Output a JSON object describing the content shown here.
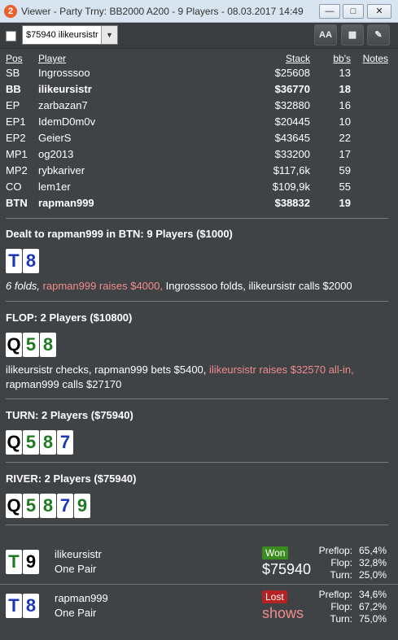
{
  "window": {
    "app_icon": "2",
    "title": "Viewer - Party Trny: BB2000 A200 - 9 Players - 08.03.2017 14:49",
    "minimize_icon": "minimize-icon",
    "maximize_icon": "maximize-icon",
    "close_icon": "close-icon"
  },
  "toolbar": {
    "hand_select_value": "$75940 ilikeursistr",
    "font_button": "AA",
    "grid_icon": "grid-icon",
    "edit_icon": "pencil-icon"
  },
  "table": {
    "headers": {
      "pos": "Pos",
      "player": "Player",
      "stack": "Stack",
      "bbs": "bb's",
      "notes": "Notes"
    },
    "rows": [
      {
        "pos": "SB",
        "player": "Ingrosssoo",
        "stack": "$25608",
        "bbs": "13",
        "bold": false
      },
      {
        "pos": "BB",
        "player": "ilikeursistr",
        "stack": "$36770",
        "bbs": "18",
        "bold": true
      },
      {
        "pos": "EP",
        "player": "zarbazan7",
        "stack": "$32880",
        "bbs": "16",
        "bold": false
      },
      {
        "pos": "EP1",
        "player": "IdemD0m0v",
        "stack": "$20445",
        "bbs": "10",
        "bold": false
      },
      {
        "pos": "EP2",
        "player": "GeierS",
        "stack": "$43645",
        "bbs": "22",
        "bold": false
      },
      {
        "pos": "MP1",
        "player": "og2013",
        "stack": "$33200",
        "bbs": "17",
        "bold": false
      },
      {
        "pos": "MP2",
        "player": "rybkariver",
        "stack": "$117,6k",
        "bbs": "59",
        "bold": false
      },
      {
        "pos": "CO",
        "player": "lem1er",
        "stack": "$109,9k",
        "bbs": "55",
        "bold": false
      },
      {
        "pos": "BTN",
        "player": "rapman999",
        "stack": "$38832",
        "bbs": "19",
        "bold": true
      }
    ]
  },
  "preflop": {
    "heading": "Dealt to rapman999 in BTN: 9 Players ($1000)",
    "cards": [
      {
        "rank": "T",
        "suit": "d"
      },
      {
        "rank": "8",
        "suit": "d"
      }
    ],
    "action_folds": "6 folds,",
    "action_raise": "rapman999 raises $4000,",
    "action_rest": "Ingrosssoo folds, ilikeursistr calls $2000"
  },
  "flop": {
    "heading": "FLOP: 2 Players ($10800)",
    "cards": [
      {
        "rank": "Q",
        "suit": "s"
      },
      {
        "rank": "5",
        "suit": "c"
      },
      {
        "rank": "8",
        "suit": "c"
      }
    ],
    "action_a": "ilikeursistr checks, rapman999 bets $5400,",
    "action_b": "ilikeursistr raises $32570 all-in,",
    "action_c": "rapman999 calls $27170"
  },
  "turn": {
    "heading": "TURN: 2 Players ($75940)",
    "cards": [
      {
        "rank": "Q",
        "suit": "s"
      },
      {
        "rank": "5",
        "suit": "c"
      },
      {
        "rank": "8",
        "suit": "c"
      },
      {
        "rank": "7",
        "suit": "d"
      }
    ]
  },
  "river": {
    "heading": "RIVER: 2 Players ($75940)",
    "cards": [
      {
        "rank": "Q",
        "suit": "s"
      },
      {
        "rank": "5",
        "suit": "c"
      },
      {
        "rank": "8",
        "suit": "c"
      },
      {
        "rank": "7",
        "suit": "d"
      },
      {
        "rank": "9",
        "suit": "c"
      }
    ]
  },
  "results": [
    {
      "cards": [
        {
          "rank": "T",
          "suit": "c"
        },
        {
          "rank": "9",
          "suit": "s"
        }
      ],
      "player": "ilikeursistr",
      "hand": "One Pair",
      "badge": "Won",
      "amount": "$75940",
      "stats": [
        {
          "label": "Preflop:",
          "value": "65,4%"
        },
        {
          "label": "Flop:",
          "value": "32,8%"
        },
        {
          "label": "Turn:",
          "value": "25,0%"
        }
      ]
    },
    {
      "cards": [
        {
          "rank": "T",
          "suit": "d"
        },
        {
          "rank": "8",
          "suit": "d"
        }
      ],
      "player": "rapman999",
      "hand": "One Pair",
      "badge": "Lost",
      "amount": "shows",
      "stats": [
        {
          "label": "Preflop:",
          "value": "34,6%"
        },
        {
          "label": "Flop:",
          "value": "67,2%"
        },
        {
          "label": "Turn:",
          "value": "75,0%"
        }
      ]
    }
  ]
}
